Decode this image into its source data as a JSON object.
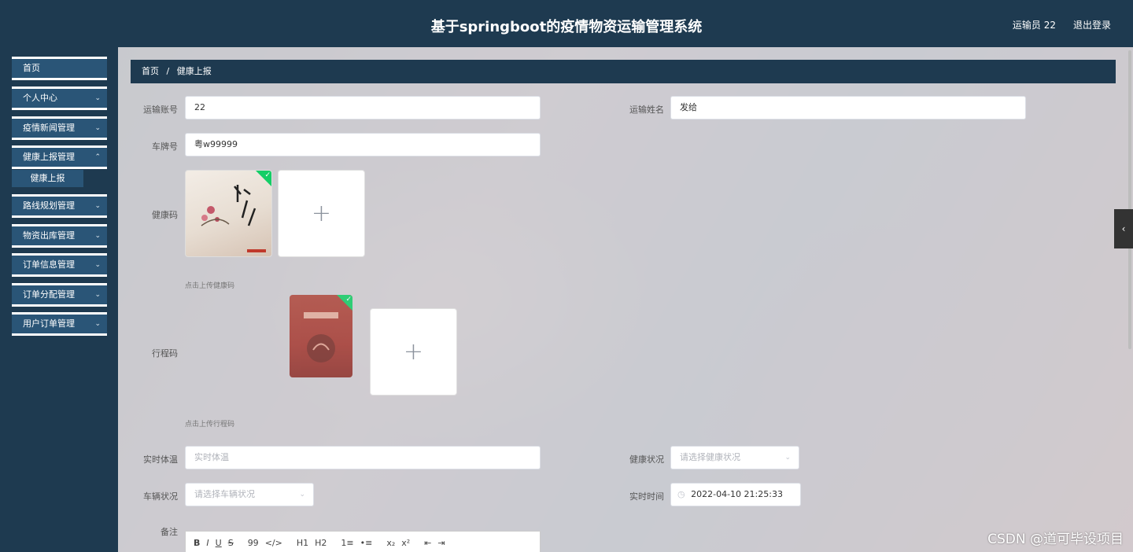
{
  "header": {
    "title": "基于springboot的疫情物资运输管理系统",
    "user": "运输员 22",
    "logout": "退出登录"
  },
  "sidebar": {
    "items": [
      {
        "label": "首页",
        "chevron": false
      },
      {
        "label": "个人中心",
        "chevron": true
      },
      {
        "label": "疫情新闻管理",
        "chevron": true
      },
      {
        "label": "健康上报管理",
        "chevron": true
      },
      {
        "label": "路线规划管理",
        "chevron": true
      },
      {
        "label": "物资出库管理",
        "chevron": true
      },
      {
        "label": "订单信息管理",
        "chevron": true
      },
      {
        "label": "订单分配管理",
        "chevron": true
      },
      {
        "label": "用户订单管理",
        "chevron": true
      }
    ],
    "submenu": {
      "label": "健康上报"
    }
  },
  "breadcrumb": {
    "home": "首页",
    "sep": "/",
    "current": "健康上报"
  },
  "form": {
    "account": {
      "label": "运输账号",
      "value": "22"
    },
    "name": {
      "label": "运输姓名",
      "value": "发给"
    },
    "plate": {
      "label": "车牌号",
      "value": "粤w99999"
    },
    "health_code": {
      "label": "健康码",
      "hint": "点击上传健康码"
    },
    "trip_code": {
      "label": "行程码",
      "hint": "点击上传行程码"
    },
    "temperature": {
      "label": "实时体温",
      "placeholder": "实时体温"
    },
    "health_status": {
      "label": "健康状况",
      "placeholder": "请选择健康状况"
    },
    "vehicle_status": {
      "label": "车辆状况",
      "placeholder": "请选择车辆状况"
    },
    "time": {
      "label": "实时时间",
      "value": "2022-04-10 21:25:33"
    },
    "remark": {
      "label": "备注"
    }
  },
  "editor_toolbar": [
    "B",
    "I",
    "U",
    "S",
    "99",
    "</>",
    "H1",
    "H2",
    "1≡",
    "•≡",
    "x₂",
    "x²",
    "⇤",
    "⇥"
  ],
  "watermark": "CSDN @道可毕设项目"
}
